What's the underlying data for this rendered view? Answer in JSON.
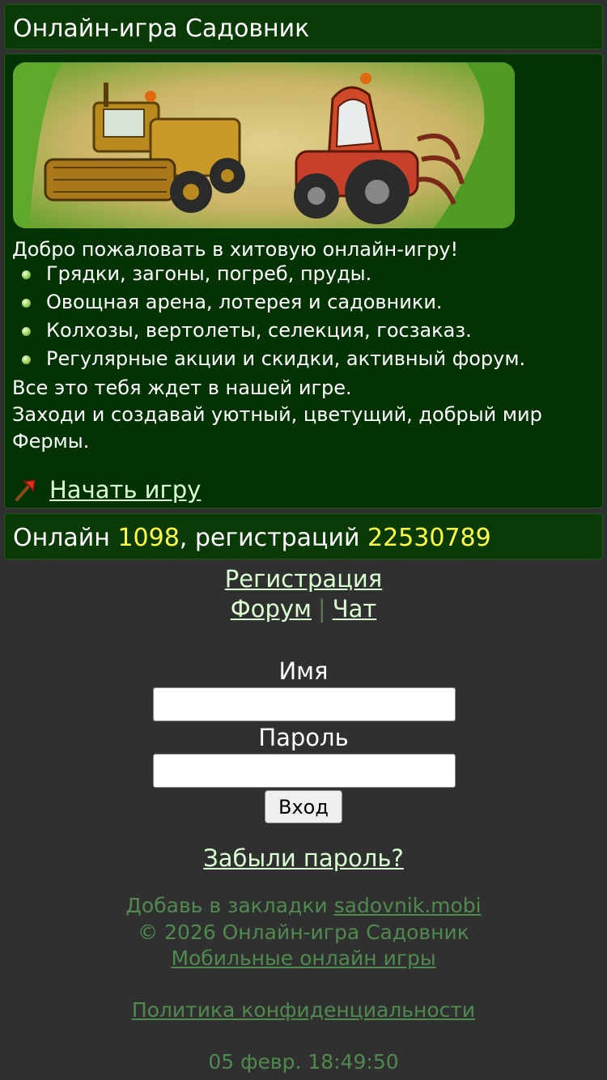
{
  "header": {
    "title": "Онлайн-игра Садовник"
  },
  "intro": {
    "welcome": "Добро пожаловать в хитовую онлайн-игру!",
    "features": [
      "Грядки, загоны, погреб, пруды.",
      "Овощная арена, лотерея и садовники.",
      "Колхозы, вертолеты, селекция, госзаказ.",
      "Регулярные акции и скидки, активный форум."
    ],
    "outro_line1": "Все это тебя ждет в нашей игре.",
    "outro_line2": "Заходи и создавай уютный, цветущий, добрый мир",
    "outro_line3": "Фермы.",
    "start_link": "Начать игру"
  },
  "stats": {
    "online_label": "Онлайн ",
    "online_count": "1098",
    "registrations_label": ", регистраций ",
    "registrations_count": "22530789"
  },
  "nav": {
    "register": "Регистрация",
    "forum": "Форум",
    "separator": "|",
    "chat": "Чат"
  },
  "login": {
    "name_label": "Имя",
    "name_value": "",
    "password_label": "Пароль",
    "password_value": "",
    "submit": "Вход",
    "forgot": "Забыли пароль?"
  },
  "footer": {
    "bookmark_prefix": "Добавь в закладки ",
    "bookmark_link": "sadovnik.mobi",
    "copyright": "© 2026 Онлайн-игра Садовник",
    "mobile_games": "Мобильные онлайн игры",
    "privacy": "Политика конфиденциальности",
    "datetime": "05 февр. 18:49:50"
  },
  "colors": {
    "page_bg": "#303030",
    "panel_bg": "#033303",
    "link": "#d9ffd2",
    "highlight": "#ffff44",
    "footer_text": "#4f8a4f"
  },
  "icons": {
    "banner": "harvester-and-tractor-illustration",
    "start": "red-axe-icon",
    "bullet": "green-bullet-icon"
  }
}
